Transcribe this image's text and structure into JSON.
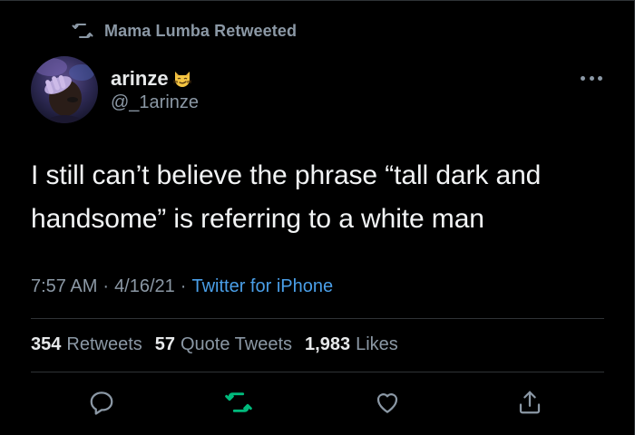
{
  "retweet_context": {
    "text": "Mama Lumba Retweeted",
    "icon": "retweet-icon"
  },
  "author": {
    "name": "arinze",
    "emoji": "smirking-cat-emoji",
    "handle": "@_1arinze",
    "avatar": "profile-photo"
  },
  "tweet": {
    "text": "I still can’t believe the phrase “tall dark and handsome” is referring to a white man"
  },
  "meta": {
    "time": "7:57 AM",
    "separator": "·",
    "date": "4/16/21",
    "source": "Twitter for iPhone"
  },
  "stats": {
    "retweets": {
      "count": "354",
      "label": "Retweets"
    },
    "quotes": {
      "count": "57",
      "label": "Quote Tweets"
    },
    "likes": {
      "count": "1,983",
      "label": "Likes"
    }
  },
  "actions": [
    {
      "name": "reply",
      "icon": "reply-icon"
    },
    {
      "name": "retweet",
      "icon": "retweet-icon"
    },
    {
      "name": "like",
      "icon": "heart-icon"
    },
    {
      "name": "share",
      "icon": "share-icon"
    }
  ],
  "colors": {
    "background": "#000000",
    "text_primary": "#e7e9ea",
    "text_secondary": "#8b98a5",
    "link": "#4a9fe8",
    "retweeted_green": "#00ba7c",
    "divider": "#2f3336"
  }
}
